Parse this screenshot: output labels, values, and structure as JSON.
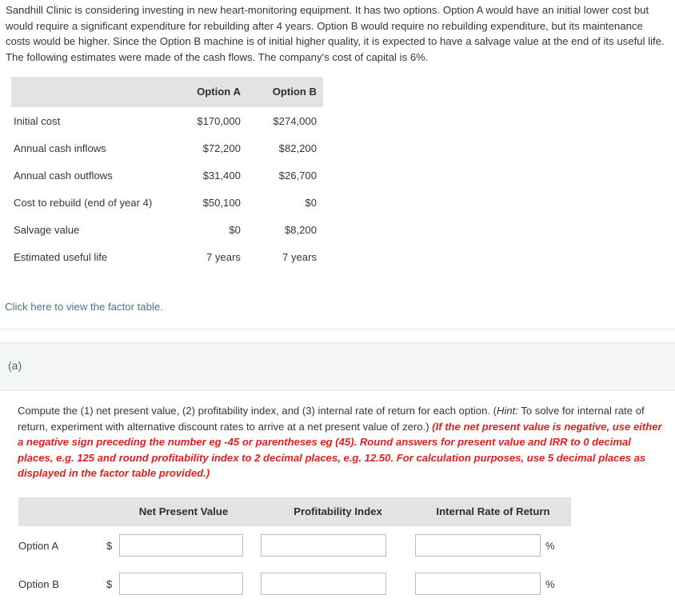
{
  "intro": {
    "paragraph": "Sandhill Clinic is considering investing in new heart-monitoring equipment. It has two options. Option A would have an initial lower cost but would require a significant expenditure for rebuilding after 4 years. Option B would require no rebuilding expenditure, but its maintenance costs would be higher. Since the Option B machine is of initial higher quality, it is expected to have a salvage value at the end of its useful life. The following estimates were made of the cash flows. The company's cost of capital is 6%."
  },
  "facts_table": {
    "blank_header": "",
    "headers": [
      "Option A",
      "Option B"
    ],
    "rows": [
      {
        "label": "Initial cost",
        "option_a": "$170,000",
        "option_b": "$274,000"
      },
      {
        "label": "Annual cash inflows",
        "option_a": "$72,200",
        "option_b": "$82,200"
      },
      {
        "label": "Annual cash outflows",
        "option_a": "$31,400",
        "option_b": "$26,700"
      },
      {
        "label": "Cost to rebuild (end of year 4)",
        "option_a": "$50,100",
        "option_b": "$0"
      },
      {
        "label": "Salvage value",
        "option_a": "$0",
        "option_b": "$8,200"
      },
      {
        "label": "Estimated useful life",
        "option_a": "7 years",
        "option_b": "7 years"
      }
    ]
  },
  "factor_link": {
    "label": "Click here to view the factor table.",
    "color": "#4a7487"
  },
  "part": {
    "label": "(a)",
    "color": "#3d6f87"
  },
  "question": {
    "lead": "Compute the (1) net present value, (2) profitability index, and (3) internal rate of return for each option. (",
    "hint_word": "Hint:",
    "hint_body": " To solve for internal rate of return, experiment with alternative discount rates to arrive at a net present value of zero.) ",
    "red_note": "(If the net present value is negative, use either a negative sign preceding the number eg -45 or parentheses eg (45). Round answers for present value and IRR to 0 decimal places, e.g. 125 and round profitability index to 2 decimal places, e.g. 12.50. For calculation purposes, use 5 decimal places as displayed in the factor table provided.)",
    "red_color": "#e02020"
  },
  "answer_table": {
    "corner_header": "",
    "headers": [
      "Net Present Value",
      "Profitability Index",
      "Internal Rate of Return"
    ],
    "prefix_dollar": "$",
    "suffix_percent": "%",
    "rows": [
      {
        "label": "Option A",
        "npv_value": "",
        "npv_placeholder": "",
        "pi_value": "",
        "pi_placeholder": "",
        "irr_value": "",
        "irr_placeholder": ""
      },
      {
        "label": "Option B",
        "npv_value": "",
        "npv_placeholder": "",
        "pi_value": "",
        "pi_placeholder": "",
        "irr_value": "",
        "irr_placeholder": ""
      }
    ]
  }
}
